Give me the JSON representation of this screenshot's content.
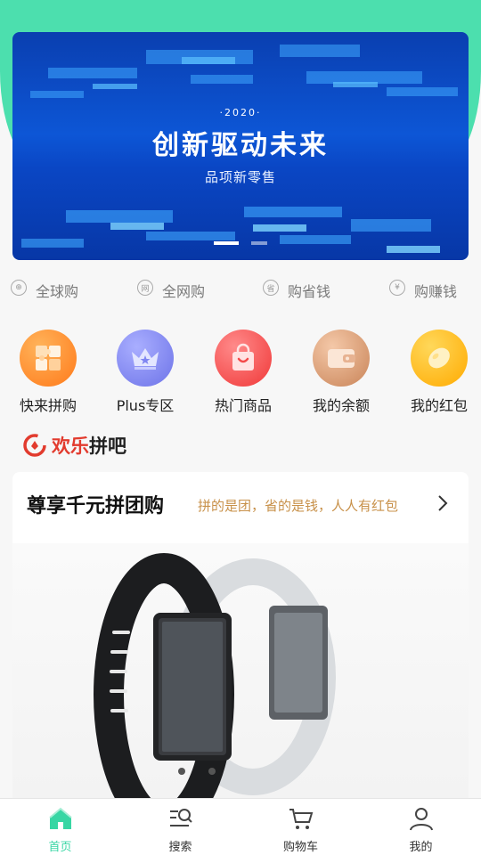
{
  "colors": {
    "accent": "#4cdfae",
    "active_tab": "#38d6a4",
    "brand_red": "#e23b2e",
    "subtitle_gold": "#c8914a"
  },
  "banner": {
    "year": "·2020·",
    "headline": "创新驱动未来",
    "subtitle": "品项新零售"
  },
  "features": [
    {
      "icon": "globe-icon",
      "icon_glyph": "⊕",
      "label": "全球购"
    },
    {
      "icon": "net-icon",
      "icon_glyph": "网",
      "label": "全网购"
    },
    {
      "icon": "save-icon",
      "icon_glyph": "省",
      "label": "购省钱"
    },
    {
      "icon": "yen-icon",
      "icon_glyph": "¥",
      "label": "购赚钱"
    }
  ],
  "categories": [
    {
      "icon": "puzzle-icon",
      "label": "快来拼购",
      "color": "#ff8a2a"
    },
    {
      "icon": "crown-icon",
      "label": "Plus专区",
      "color": "#7f86f2"
    },
    {
      "icon": "shopping-bag-icon",
      "label": "热门商品",
      "color": "#f44a4a"
    },
    {
      "icon": "wallet-icon",
      "label": "我的余额",
      "color": "#e0a27c"
    },
    {
      "icon": "red-packet-icon",
      "label": "我的红包",
      "color": "#ffbf1f"
    }
  ],
  "brand": {
    "text_red": "欢乐",
    "text_black": "拼吧"
  },
  "group_buy": {
    "title": "尊享千元拼团购",
    "subtitle": "拼的是团，省的是钱，人人有红包"
  },
  "tabs": [
    {
      "icon": "home-icon",
      "label": "首页",
      "active": true
    },
    {
      "icon": "search-icon",
      "label": "搜索",
      "active": false
    },
    {
      "icon": "cart-icon",
      "label": "购物车",
      "active": false
    },
    {
      "icon": "user-icon",
      "label": "我的",
      "active": false
    }
  ]
}
